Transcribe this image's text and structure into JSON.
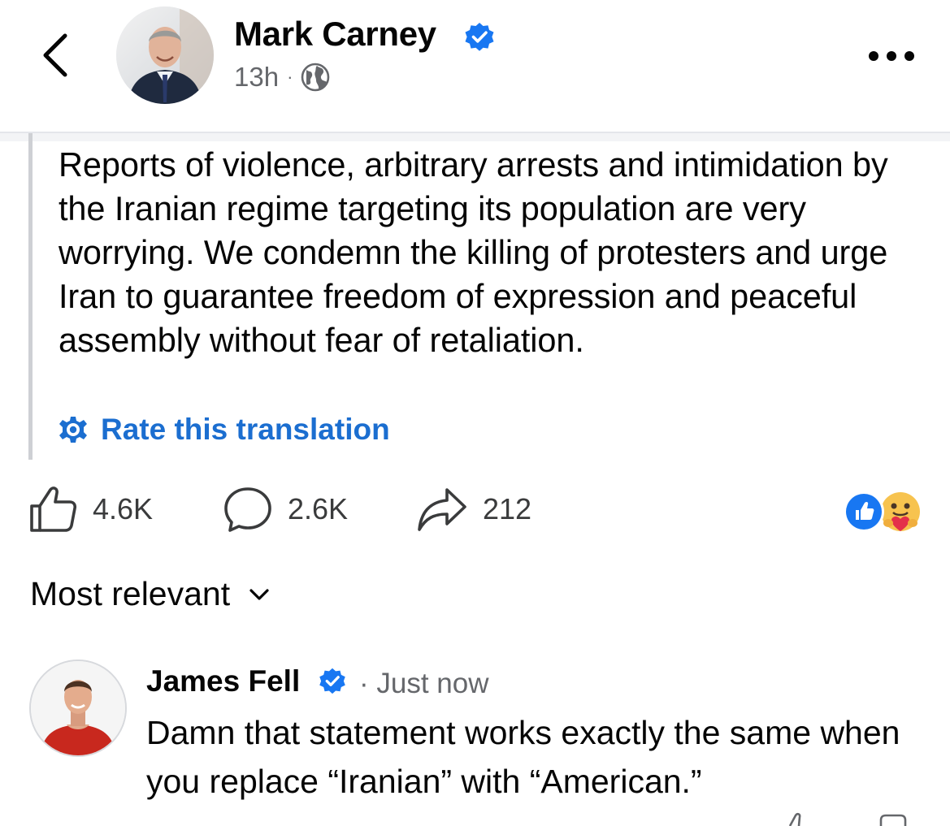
{
  "post": {
    "author": "Mark Carney",
    "timestamp": "13h",
    "separator": "·",
    "audience_icon": "globe-icon",
    "text": "Reports of violence, arbitrary arrests and intimidation by the Iranian regime targeting its population are very worrying. We condemn the killing of protesters and urge Iran to guarantee freedom of expression and peaceful assembly without fear of retaliation.",
    "rate_translation": "Rate this translation"
  },
  "actions": {
    "likes": "4.6K",
    "comments": "2.6K",
    "shares": "212",
    "reaction_icons": [
      "like-reaction-icon",
      "care-reaction-icon"
    ]
  },
  "comments_section": {
    "sort_label": "Most relevant"
  },
  "comment": {
    "author": "James Fell",
    "separator": "·",
    "timestamp": "Just now",
    "text": "Damn that statement works exactly the same when you replace “Iranian” with “American.”"
  },
  "colors": {
    "verified": "#1877f2",
    "link": "#1b6ed0",
    "muted": "#65676b",
    "like_blue": "#1877f2"
  }
}
